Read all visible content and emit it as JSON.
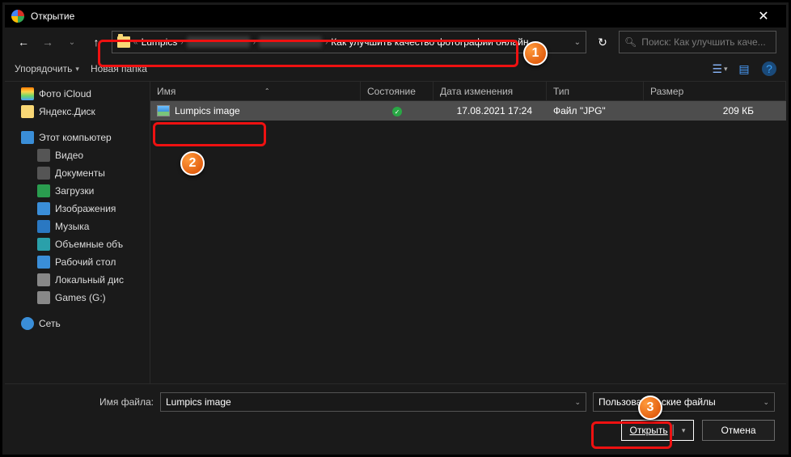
{
  "title": "Открытие",
  "breadcrumb": {
    "sep_first": "«",
    "items": [
      "Lumpics",
      "",
      "Как улучшить качество фотографии онлайн"
    ]
  },
  "search": {
    "placeholder": "Поиск: Как улучшить каче..."
  },
  "toolbar": {
    "organize": "Упорядочить",
    "newfolder": "Новая папка"
  },
  "columns": {
    "name": "Имя",
    "state": "Состояние",
    "date": "Дата изменения",
    "type": "Тип",
    "size": "Размер"
  },
  "sidebar": {
    "icloud": "Фото iCloud",
    "yadisk": "Яндекс.Диск",
    "thispc": "Этот компьютер",
    "video": "Видео",
    "docs": "Документы",
    "downloads": "Загрузки",
    "images": "Изображения",
    "music": "Музыка",
    "objects3d": "Объемные объ",
    "desktop": "Рабочий стол",
    "localdisk": "Локальный дис",
    "games": "Games (G:)",
    "network": "Сеть"
  },
  "file": {
    "name": "Lumpics image",
    "date": "17.08.2021 17:24",
    "type": "Файл \"JPG\"",
    "size": "209 КБ"
  },
  "bottom": {
    "filename_label": "Имя файла:",
    "filename_value": "Lumpics image",
    "filter": "Пользовательские файлы",
    "open": "Открыть",
    "cancel": "Отмена"
  },
  "annotations": {
    "b1": "1",
    "b2": "2",
    "b3": "3"
  }
}
